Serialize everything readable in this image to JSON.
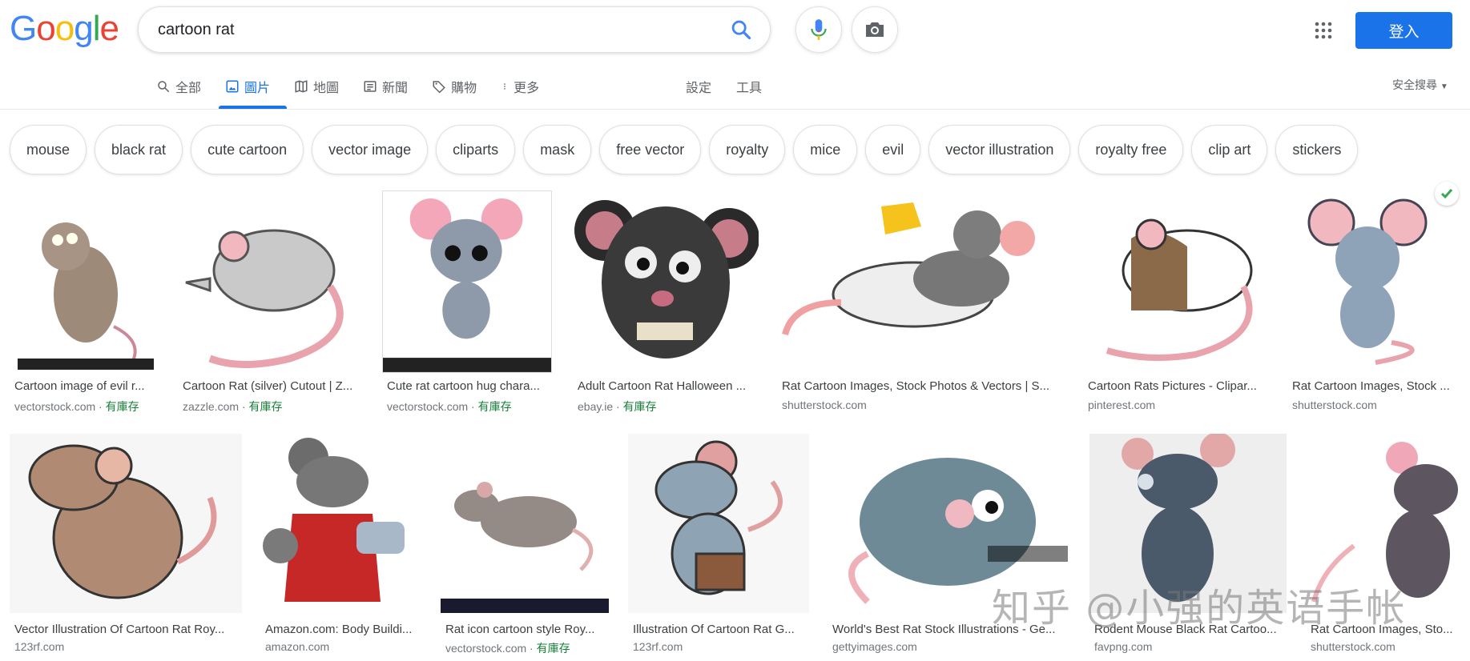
{
  "header": {
    "logo": [
      "G",
      "o",
      "o",
      "g",
      "l",
      "e"
    ],
    "logo_colors": [
      "#4285f4",
      "#ea4335",
      "#fbbc05",
      "#4285f4",
      "#34a853",
      "#ea4335"
    ],
    "search_value": "cartoon rat",
    "signin_label": "登入",
    "accent_color": "#1a73e8"
  },
  "tabs": [
    {
      "label": "全部",
      "icon": "search-icon"
    },
    {
      "label": "圖片",
      "icon": "image-icon",
      "active": true
    },
    {
      "label": "地圖",
      "icon": "map-icon"
    },
    {
      "label": "新聞",
      "icon": "news-icon"
    },
    {
      "label": "購物",
      "icon": "tag-icon"
    },
    {
      "label": "更多",
      "icon": "more-vert-icon"
    }
  ],
  "tools": {
    "settings": "設定",
    "tools": "工具",
    "safe_search": "安全搜尋"
  },
  "chips": [
    "mouse",
    "black rat",
    "cute cartoon",
    "vector image",
    "cliparts",
    "mask",
    "free vector",
    "royalty",
    "mice",
    "evil",
    "vector illustration",
    "royalty free",
    "clip art",
    "stickers"
  ],
  "results_row1": [
    {
      "title": "Cartoon image of evil r...",
      "source": "vectorstock.com",
      "stock": "有庫存"
    },
    {
      "title": "Cartoon Rat (silver) Cutout | Z...",
      "source": "zazzle.com",
      "stock": "有庫存"
    },
    {
      "title": "Cute rat cartoon hug chara...",
      "source": "vectorstock.com",
      "stock": "有庫存"
    },
    {
      "title": "Adult Cartoon Rat Halloween ...",
      "source": "ebay.ie",
      "stock": "有庫存"
    },
    {
      "title": "Rat Cartoon Images, Stock Photos & Vectors | S...",
      "source": "shutterstock.com",
      "stock": ""
    },
    {
      "title": "Cartoon Rats Pictures - Clipar...",
      "source": "pinterest.com",
      "stock": ""
    },
    {
      "title": "Rat Cartoon Images, Stock ...",
      "source": "shutterstock.com",
      "stock": ""
    }
  ],
  "results_row2": [
    {
      "title": "Vector Illustration Of Cartoon Rat Roy...",
      "source": "123rf.com",
      "stock": ""
    },
    {
      "title": "Amazon.com: Body Buildi...",
      "source": "amazon.com",
      "stock": ""
    },
    {
      "title": "Rat icon cartoon style Roy...",
      "source": "vectorstock.com",
      "stock": "有庫存"
    },
    {
      "title": "Illustration Of Cartoon Rat G...",
      "source": "123rf.com",
      "stock": ""
    },
    {
      "title": "World's Best Rat Stock Illustrations - Ge...",
      "source": "gettyimages.com",
      "stock": ""
    },
    {
      "title": "Rodent Mouse Black Rat Cartoo...",
      "source": "favpng.com",
      "stock": ""
    },
    {
      "title": "Rat Cartoon Images, Sto...",
      "source": "shutterstock.com",
      "stock": ""
    }
  ],
  "watermark": "知乎 @小强的英语手帐",
  "stock_separator": " · "
}
